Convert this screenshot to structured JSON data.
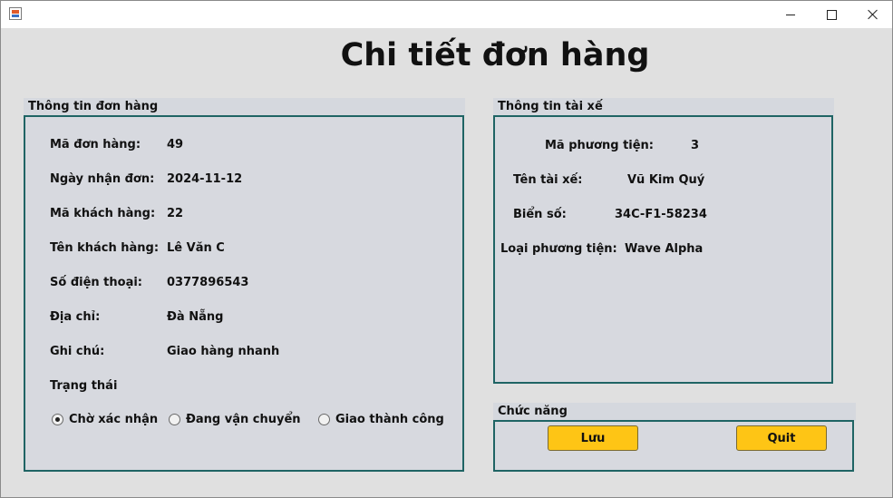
{
  "window": {
    "title": "",
    "app_icon": "java-app-icon",
    "controls": [
      "minimize-icon",
      "maximize-icon",
      "close-icon"
    ]
  },
  "page_title": "Chi tiết đơn hàng",
  "order_panel": {
    "header": "Thông tin đơn hàng",
    "fields": [
      {
        "label": "Mã đơn hàng:",
        "value": "49"
      },
      {
        "label": "Ngày nhận đơn:",
        "value": "2024-11-12"
      },
      {
        "label": "Mã khách hàng:",
        "value": "22"
      },
      {
        "label": "Tên khách hàng:",
        "value": "Lê Văn C"
      },
      {
        "label": "Số điện thoại:",
        "value": "0377896543"
      },
      {
        "label": "Địa chỉ:",
        "value": "Đà Nẵng"
      },
      {
        "label": "Ghi chú:",
        "value": "Giao hàng nhanh"
      }
    ],
    "status_label": "Trạng thái",
    "status_options": [
      "Chờ xác nhận",
      "Đang vận chuyển",
      "Giao thành công"
    ],
    "status_selected": "Chờ xác nhận"
  },
  "driver_panel": {
    "header": "Thông tin tài xế",
    "fields": [
      {
        "label": "Mã phương tiện:",
        "value": "3"
      },
      {
        "label": "Tên tài xế:",
        "value": "Vũ Kim Quý"
      },
      {
        "label": "Biển số:",
        "value": "34C-F1-58234"
      },
      {
        "label": "Loại phương tiện:",
        "value": "Wave Alpha"
      }
    ]
  },
  "function_panel": {
    "header": "Chức năng",
    "save_label": "Lưu",
    "quit_label": "Quit"
  },
  "colors": {
    "panel_border": "#1f6464",
    "panel_bg": "#d7d9df",
    "button_bg": "#fec515",
    "window_bg": "#e0e0e0"
  }
}
